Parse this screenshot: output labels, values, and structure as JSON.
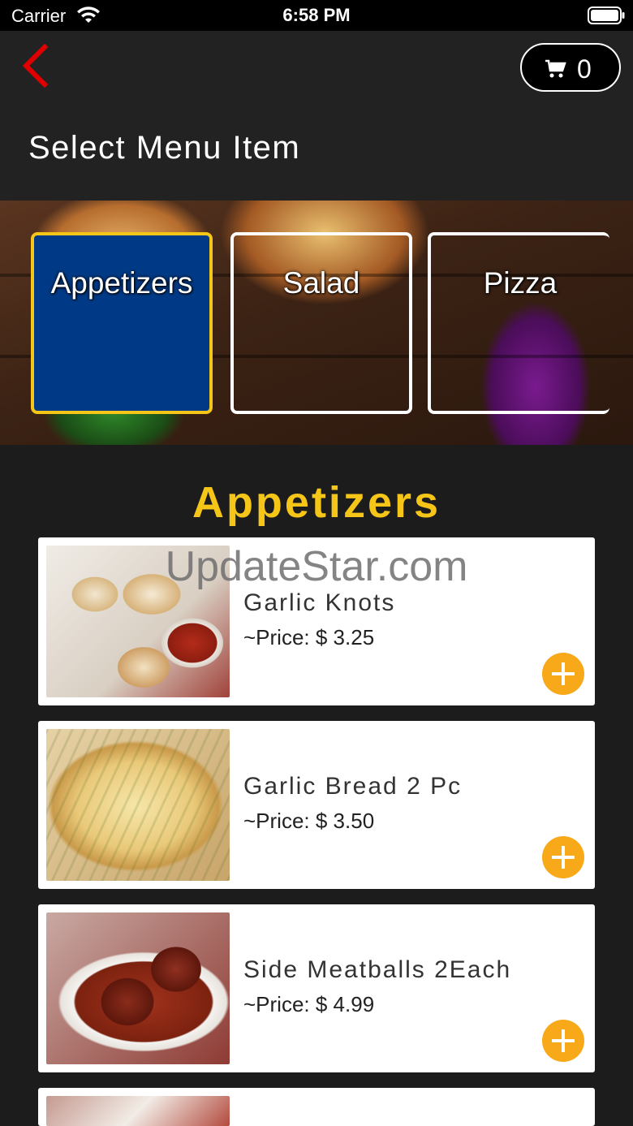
{
  "status_bar": {
    "carrier": "Carrier",
    "time": "6:58 PM"
  },
  "header": {
    "title": "Select Menu Item",
    "cart_count": "0"
  },
  "categories": [
    {
      "label": "Appetizers",
      "selected": true
    },
    {
      "label": "Salad",
      "selected": false
    },
    {
      "label": "Pizza",
      "selected": false
    }
  ],
  "section": {
    "title": "Appetizers"
  },
  "items": [
    {
      "name": "Garlic Knots",
      "price": "~Price: $ 3.25"
    },
    {
      "name": "Garlic Bread 2 Pc",
      "price": "~Price: $ 3.50"
    },
    {
      "name": "Side Meatballs 2Each",
      "price": "~Price: $ 4.99"
    }
  ],
  "watermark": "UpdateStar.com",
  "colors": {
    "accent": "#f5c518",
    "selected_category": "#003a86",
    "add_button": "#f8a91a",
    "back_arrow": "#e00000"
  },
  "icons": {
    "back": "back-chevron-icon",
    "cart": "cart-icon",
    "add": "plus-icon",
    "wifi": "wifi-icon",
    "battery": "battery-icon"
  }
}
